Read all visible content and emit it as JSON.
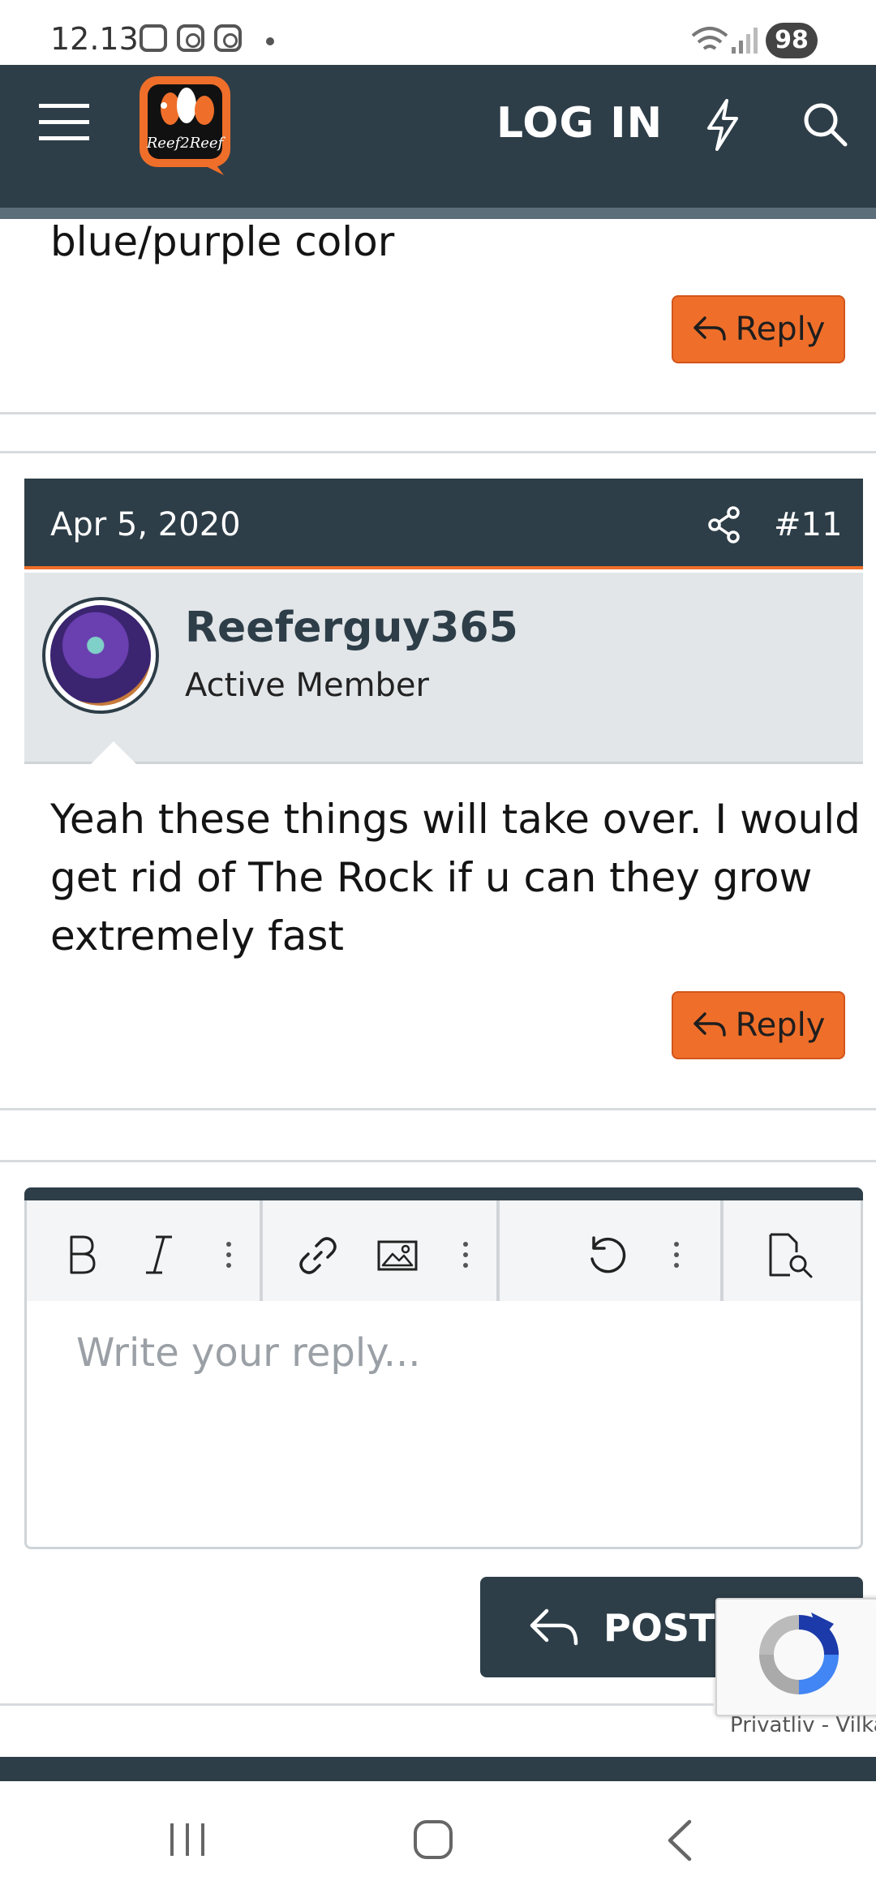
{
  "status_bar": {
    "time": "12.13",
    "battery": "98",
    "icons": [
      "gallery-icon",
      "instagram-icon",
      "instagram-icon",
      "dot-icon",
      "wifi-icon",
      "signal-icon"
    ]
  },
  "header": {
    "menu_icon": "hamburger-icon",
    "logo_text": "Reef2Reef",
    "login_label": "LOG IN",
    "whats_new_icon": "lightning-icon",
    "search_icon": "search-icon"
  },
  "previous_post": {
    "text_tail": "blue/purple color",
    "reply_label": "Reply"
  },
  "post": {
    "date": "Apr 5, 2020",
    "number": "#11",
    "username": "Reeferguy365",
    "user_title": "Active Member",
    "body_lines": [
      "Yeah these things will take over. I would",
      "get rid of The Rock if u can they grow",
      "extremely fast"
    ],
    "reply_label": "Reply"
  },
  "editor": {
    "placeholder": "Write your reply...",
    "tools": [
      "bold-icon",
      "italic-icon",
      "more-icon",
      "link-icon",
      "image-icon",
      "more-icon",
      "undo-icon",
      "more-icon",
      "preview-icon"
    ]
  },
  "post_reply": {
    "label": "POST R"
  },
  "recaptcha": {
    "privacy": "Privatliv",
    "separator": "-",
    "terms": "Vilkår"
  },
  "colors": {
    "header_bg": "#2e3e48",
    "accent_orange": "#ef6f2a",
    "user_block_bg": "#e2e6e9"
  }
}
